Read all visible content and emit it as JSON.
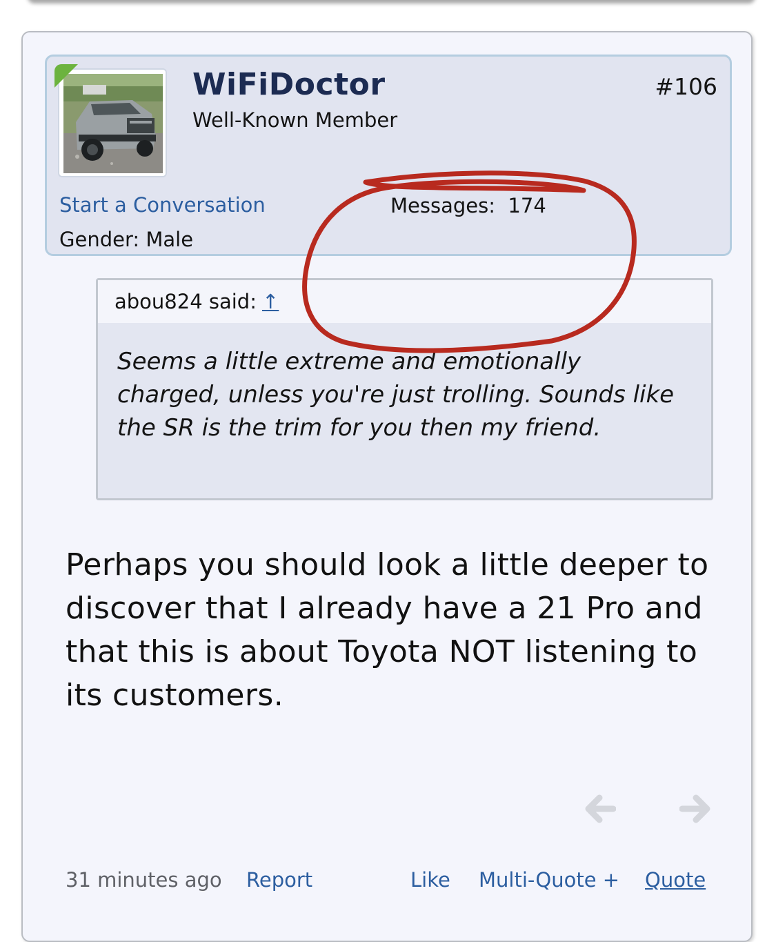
{
  "post": {
    "author": {
      "username": "WiFiDoctor",
      "title": "Well-Known Member",
      "start_conversation": "Start a Conversation",
      "gender_label": "Gender:",
      "gender_value": "Male",
      "messages_label": "Messages:",
      "messages_value": "174"
    },
    "number": "#106",
    "quote": {
      "author": "abou824 said:",
      "up_arrow": "↑",
      "text": "Seems a little extreme and emotionally charged, unless you're just trolling. Sounds like the SR is the trim for you then my friend."
    },
    "message": "Perhaps you should look a little deeper to discover that I already have a 21 Pro and that this is about Toyota NOT listening to its customers.",
    "footer": {
      "time": "31 minutes ago",
      "report": "Report",
      "like": "Like",
      "multi_quote": "Multi-Quote +",
      "quote": "Quote"
    },
    "nav": {
      "prev_icon": "arrow-left-icon",
      "next_icon": "arrow-right-icon"
    }
  },
  "colors": {
    "username": "#1c2b52",
    "link": "#2c5ea0",
    "userblock_bg": "#e1e4f0",
    "userblock_border": "#b4cde0",
    "quote_bg": "#e3e6f1",
    "annotation_circle": "#b82a1f",
    "online_indicator": "#6cb33e"
  }
}
